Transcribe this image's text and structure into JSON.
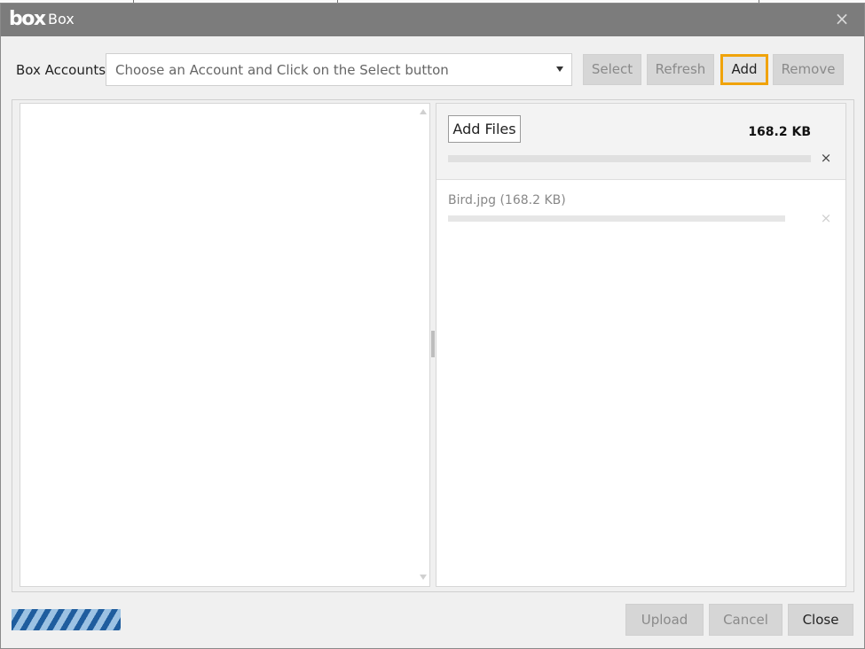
{
  "window": {
    "logo_text": "box",
    "title": "Box",
    "close_glyph": "×"
  },
  "accounts": {
    "label": "Box Accounts",
    "selected_value": "Choose an Account and Click on the Select button"
  },
  "toolbar": {
    "select_label": "Select",
    "refresh_label": "Refresh",
    "add_label": "Add",
    "remove_label": "Remove"
  },
  "upload_panel": {
    "add_files_label": "Add Files",
    "total_size": "168.2 KB",
    "total_progress": 0,
    "remove_all_glyph": "×",
    "files": [
      {
        "name": "Bird.jpg",
        "size": "(168.2 KB)",
        "progress": 0,
        "remove_glyph": "×"
      }
    ]
  },
  "footer": {
    "upload_label": "Upload",
    "cancel_label": "Cancel",
    "close_label": "Close"
  },
  "colors": {
    "titlebar": "#7c7c7c",
    "highlight": "#f0a30a",
    "progress_dark": "#1f5d9e",
    "progress_light": "#9cc2e3"
  }
}
